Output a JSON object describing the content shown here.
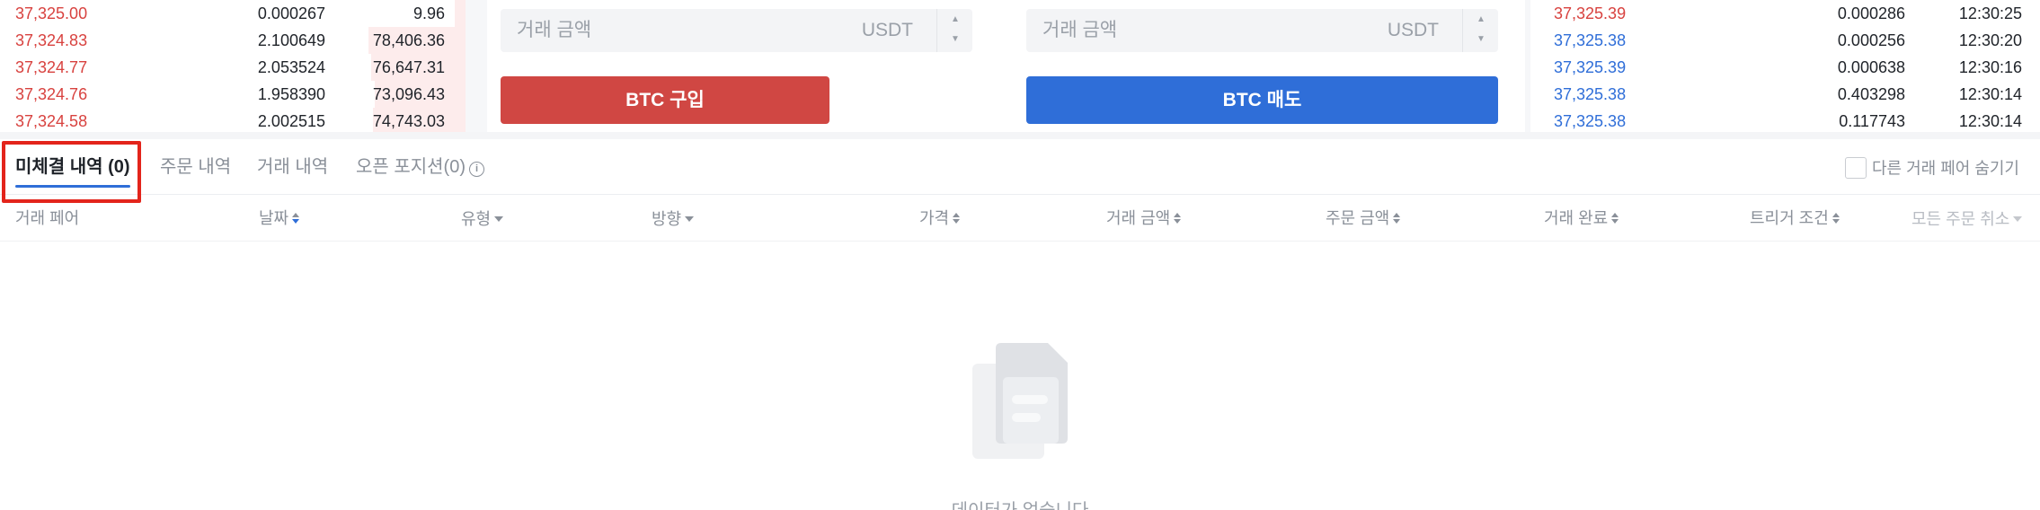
{
  "orderbook": {
    "rows": [
      {
        "price": "37,325.00",
        "amount": "0.000267",
        "total": "9.96",
        "depth": 0.1
      },
      {
        "price": "37,324.83",
        "amount": "2.100649",
        "total": "78,406.36",
        "depth": 0.92
      },
      {
        "price": "37,324.77",
        "amount": "2.053524",
        "total": "76,647.31",
        "depth": 0.9
      },
      {
        "price": "37,324.76",
        "amount": "1.958390",
        "total": "73,096.43",
        "depth": 0.86
      },
      {
        "price": "37,324.58",
        "amount": "2.002515",
        "total": "74,743.03",
        "depth": 0.88
      }
    ]
  },
  "buy_panel": {
    "input_placeholder": "거래 금액",
    "unit": "USDT",
    "button_label": "BTC 구입"
  },
  "sell_panel": {
    "input_placeholder": "거래 금액",
    "unit": "USDT",
    "button_label": "BTC 매도"
  },
  "recent_trades": {
    "rows": [
      {
        "price": "37,325.39",
        "amount": "0.000286",
        "time": "12:30:25",
        "side": "sell"
      },
      {
        "price": "37,325.38",
        "amount": "0.000256",
        "time": "12:30:20",
        "side": "buy"
      },
      {
        "price": "37,325.39",
        "amount": "0.000638",
        "time": "12:30:16",
        "side": "buy"
      },
      {
        "price": "37,325.38",
        "amount": "0.403298",
        "time": "12:30:14",
        "side": "buy"
      },
      {
        "price": "37,325.38",
        "amount": "0.117743",
        "time": "12:30:14",
        "side": "buy"
      }
    ]
  },
  "tabs": [
    {
      "label": "미체결 내역 (0)",
      "active": true
    },
    {
      "label": "주문 내역",
      "active": false
    },
    {
      "label": "거래 내역",
      "active": false
    },
    {
      "label": "오픈 포지션(0)",
      "active": false
    }
  ],
  "hide_other_pairs_label": "다른 거래 페어 숨기기",
  "columns": {
    "pair": "거래 페어",
    "date": "날짜",
    "type": "유형",
    "direction": "방향",
    "price": "가격",
    "trade_amount": "거래 금액",
    "order_amount": "주문 금액",
    "filled": "거래 완료",
    "trigger": "트리거 조건",
    "cancel_all": "모든 주문 취소"
  },
  "empty_text": "데이터가 없습니다",
  "colors": {
    "ask": "#d8423f",
    "bid": "#2f6ed8",
    "highlight": "#e3241b"
  },
  "icons": {
    "info": "info-circle-icon",
    "sort": "sort-arrows-icon",
    "dropdown": "caret-down-icon",
    "empty": "empty-document-icon"
  }
}
